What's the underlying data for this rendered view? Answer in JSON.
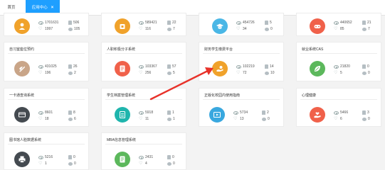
{
  "tabs": {
    "home": "首页",
    "active": "应用中心",
    "close_glyph": "×"
  },
  "cards": {
    "row0_c0": {
      "views": "1701631",
      "hearts": "1997",
      "likes": "506",
      "comments": "105",
      "icon": "user-badge-icon",
      "color": "#f0a22b"
    },
    "row0_c1": {
      "views": "589421",
      "hearts": "116",
      "likes": "22",
      "comments": "7",
      "icon": "cup-icon",
      "color": "#f0a22b"
    },
    "row0_c2": {
      "views": "454726",
      "hearts": "34",
      "likes": "5",
      "comments": "0",
      "icon": "graduation-cap-icon",
      "color": "#4ab7e6"
    },
    "row0_c3": {
      "views": "440652",
      "hearts": "85",
      "likes": "21",
      "comments": "7",
      "icon": "gamepad-icon",
      "color": "#f0614a"
    },
    "row1_c0": {
      "title": "自习室座位预约",
      "views": "431025",
      "hearts": "196",
      "likes": "26",
      "comments": "2",
      "icon": "leaf-pen-icon",
      "color": "#c9a588"
    },
    "row1_c1": {
      "title": "人职积极分子系统",
      "views": "103367",
      "hearts": "256",
      "likes": "57",
      "comments": "5",
      "icon": "document-icon",
      "color": "#f0614a"
    },
    "row1_c2": {
      "title": "财务学生缴费平台",
      "views": "102219",
      "hearts": "72",
      "likes": "14",
      "comments": "10",
      "icon": "hand-coin-icon",
      "color": "#f0a22b"
    },
    "row1_c3": {
      "title": "就业系统CAS",
      "views": "21820",
      "hearts": "5",
      "likes": "0",
      "comments": "0",
      "icon": "leaf-icon",
      "color": "#5cb85c"
    },
    "row2_c0": {
      "title": "一卡通查询系统",
      "views": "8601",
      "hearts": "18",
      "likes": "8",
      "comments": "6",
      "icon": "card-icon",
      "color": "#444a50"
    },
    "row2_c1": {
      "title": "学生档案管理系统",
      "views": "5918",
      "hearts": "11",
      "likes": "1",
      "comments": "1",
      "icon": "list-doc-icon",
      "color": "#1fb5ad"
    },
    "row2_c2": {
      "title": "正版化校园内使用指南",
      "views": "5734",
      "hearts": "13",
      "likes": "2",
      "comments": "0",
      "icon": "video-icon",
      "color": "#39a8df"
    },
    "row2_c3": {
      "title": "心理健康",
      "views": "5466",
      "hearts": "6",
      "likes": "3",
      "comments": "0",
      "icon": "hand-heart-icon",
      "color": "#f0614a"
    },
    "row3_c0": {
      "title": "图书馆人脸数据系统",
      "views": "5216",
      "hearts": "1",
      "likes": "0",
      "comments": "0",
      "icon": "printer-icon",
      "color": "#444a50"
    },
    "row3_c1": {
      "title": "MBA信息管理系统",
      "views": "2431",
      "hearts": "4",
      "likes": "0",
      "comments": "0",
      "icon": "document-icon",
      "color": "#5cb85c"
    }
  }
}
